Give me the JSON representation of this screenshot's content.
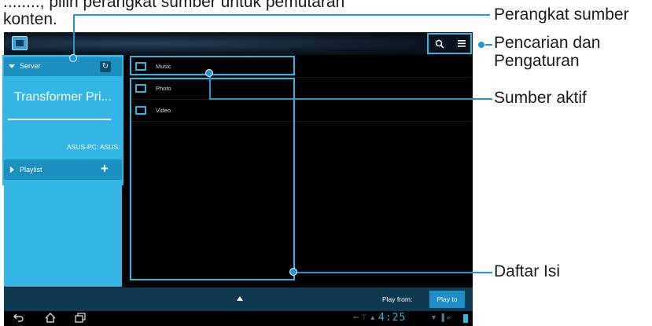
{
  "caption": {
    "line1": "........, pilih perangkat sumber untuk pemutaran",
    "line2": "konten."
  },
  "app": {
    "server_label": "Server",
    "device_name": "Transformer Pri...",
    "source_label": "ASUS-PC: ASUS:",
    "playlist_label": "Playlist",
    "folders": [
      "Music",
      "Photo",
      "Video"
    ],
    "play_from_label": "Play from:",
    "play_to_label": "Play to",
    "clock": "4:25"
  },
  "callouts": {
    "source_device": "Perangkat sumber",
    "search_settings_1": "Pencarian dan",
    "search_settings_2": "Pengaturan",
    "active_source": "Sumber aktif",
    "content_list": "Daftar Isi"
  },
  "colors": {
    "accent": "#33b5e5",
    "callout_line": "#1e98d6",
    "sidebar_dark": "#1a8fc0"
  },
  "icons": [
    "app-icon",
    "search-icon",
    "menu-icon",
    "refresh-icon",
    "add-icon",
    "folder-icon",
    "back-icon",
    "home-icon",
    "recent-apps-icon"
  ]
}
